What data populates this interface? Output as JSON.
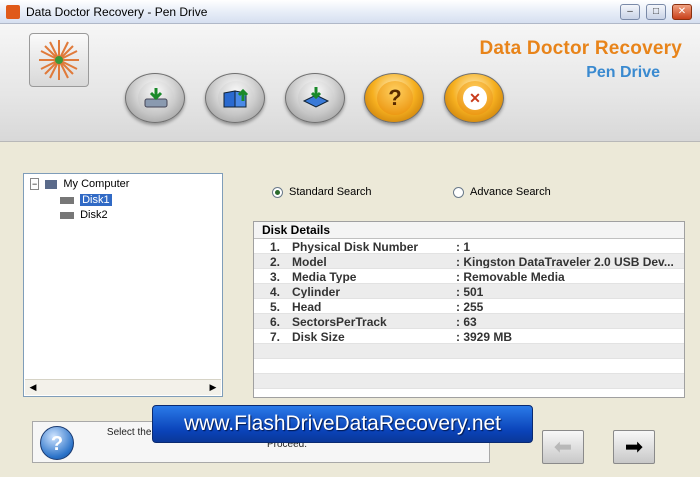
{
  "window": {
    "title": "Data Doctor Recovery - Pen Drive",
    "minimize_glyph": "–",
    "maximize_glyph": "□",
    "close_glyph": "✕"
  },
  "header": {
    "brand_title": "Data Doctor Recovery",
    "brand_subtitle": "Pen Drive",
    "toolbar": [
      {
        "icon": "open-disk-icon"
      },
      {
        "icon": "book-upload-icon"
      },
      {
        "icon": "save-disk-icon"
      },
      {
        "icon": "help-icon",
        "glyph": "?"
      },
      {
        "icon": "close-icon",
        "glyph": "✕"
      }
    ],
    "accent_orange": "#e8841a",
    "accent_blue": "#3a8ad0"
  },
  "tree": {
    "root": "My Computer",
    "items": [
      "Disk1",
      "Disk2"
    ],
    "selected": "Disk1",
    "scroll_left": "◀",
    "scroll_right": "▶"
  },
  "search": {
    "standard_label": "Standard Search",
    "advance_label": "Advance Search",
    "selected": "standard"
  },
  "disk_details": {
    "header": "Disk Details",
    "rows": [
      {
        "num": "1.",
        "key": "Physical Disk Number",
        "value": ": 1"
      },
      {
        "num": "2.",
        "key": "Model",
        "value": ": Kingston DataTraveler 2.0 USB Dev..."
      },
      {
        "num": "3.",
        "key": "Media Type",
        "value": ": Removable Media"
      },
      {
        "num": "4.",
        "key": "Cylinder",
        "value": ": 501"
      },
      {
        "num": "5.",
        "key": "Head",
        "value": ": 255"
      },
      {
        "num": "6.",
        "key": "SectorsPerTrack",
        "value": ": 63"
      },
      {
        "num": "7.",
        "key": "Disk Size",
        "value": ": 3929 MB"
      }
    ]
  },
  "status": {
    "help_glyph": "?",
    "text": "Select the disk (Standard Search or Advanced Search) and Press 'Next' Button to Proceed."
  },
  "banner": {
    "text": "www.FlashDriveDataRecovery.net"
  },
  "nav": {
    "back_glyph": "⬅",
    "next_glyph": "➡"
  }
}
